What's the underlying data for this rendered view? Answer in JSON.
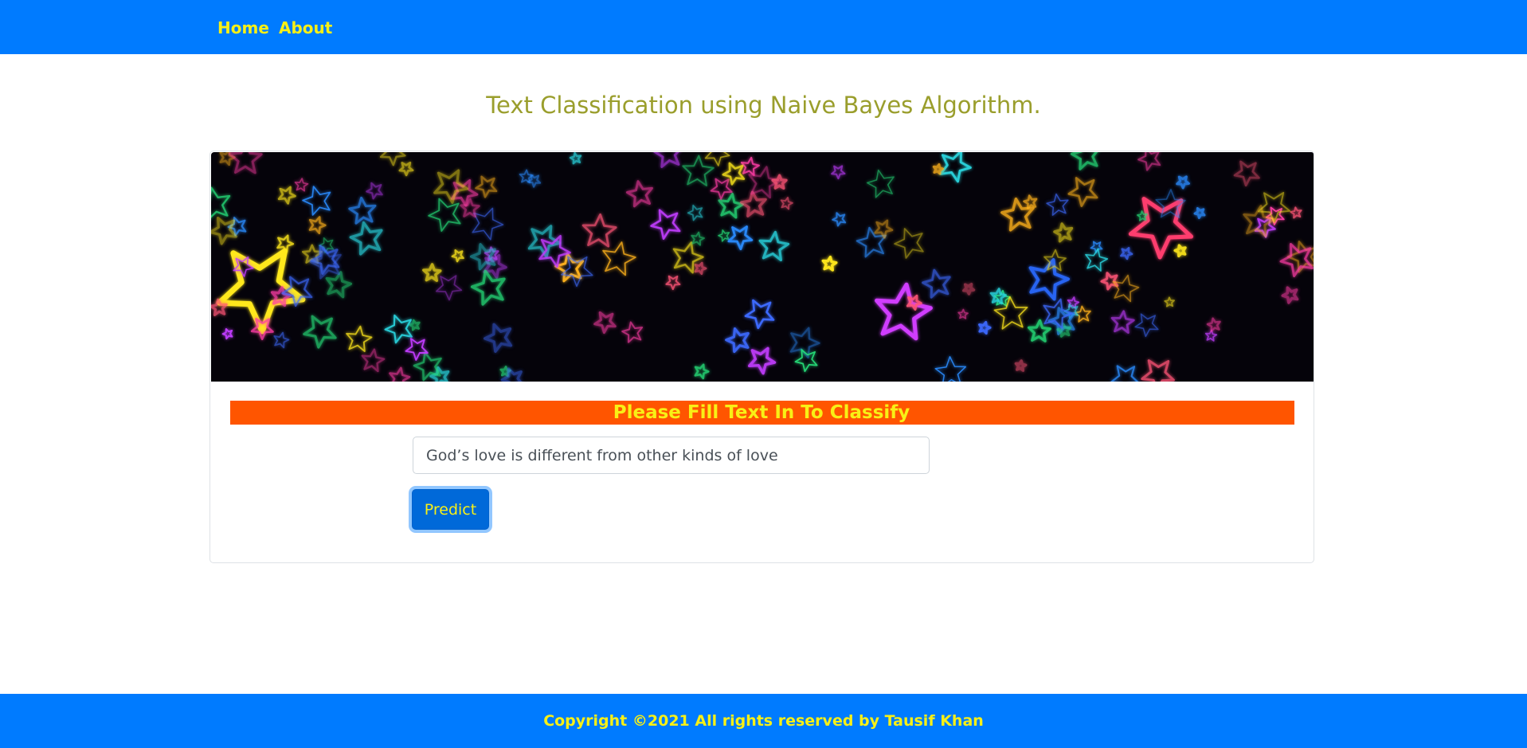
{
  "nav": {
    "home_label": "Home",
    "about_label": "About"
  },
  "main": {
    "title": "Text Classification using Naive Bayes Algorithm.",
    "instruction": "Please Fill Text In To Classify",
    "input_value": "God’s love is different from other kinds of love",
    "predict_label": "Predict"
  },
  "banner": {
    "image_description": "neon-stars-icon"
  },
  "footer": {
    "copyright": "Copyright ©2021 All rights reserved by Tausif Khan"
  },
  "colors": {
    "navbar": "#007bff",
    "accent_text": "#f8f016",
    "title": "#9a9e2c",
    "instruction_bar": "#ff5500",
    "button": "#0069d9"
  }
}
